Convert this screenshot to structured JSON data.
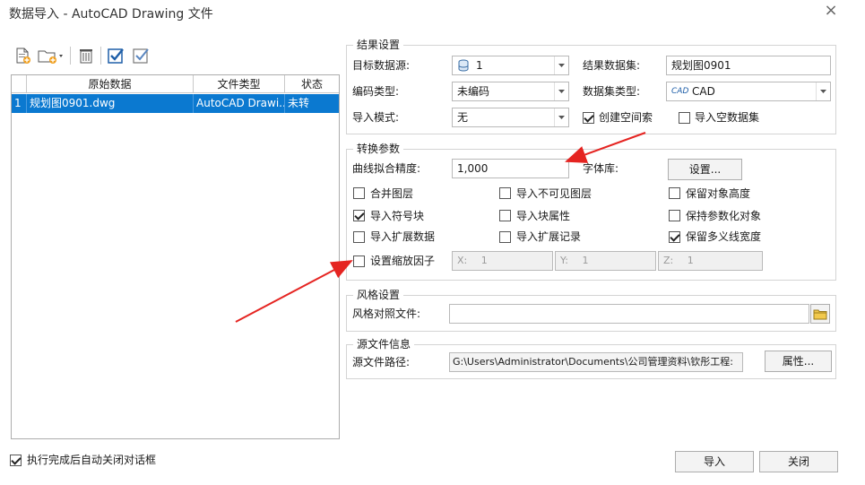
{
  "window": {
    "title": "数据导入 - AutoCAD Drawing 文件",
    "close_glyph": "×"
  },
  "grid": {
    "columns": [
      "",
      "原始数据",
      "文件类型",
      "状态"
    ],
    "rows": [
      {
        "index": "1",
        "source": "规划图0901.dwg",
        "type": "AutoCAD Drawi...",
        "status": "未转"
      }
    ]
  },
  "result": {
    "group_label": "结果设置",
    "target_ds_label": "目标数据源:",
    "target_ds_value": "1",
    "result_dataset_label": "结果数据集:",
    "result_dataset_value": "规划图0901",
    "encoding_label": "编码类型:",
    "encoding_value": "未编码",
    "dataset_type_label": "数据集类型:",
    "dataset_type_value": "CAD",
    "dataset_type_icon_text": "CAD",
    "import_mode_label": "导入模式:",
    "import_mode_value": "无",
    "create_spatial_index": "创建空间索",
    "create_spatial_index_checked": true,
    "import_empty_dataset": "导入空数据集",
    "import_empty_dataset_checked": false
  },
  "conversion": {
    "group_label": "转换参数",
    "curve_precision_label": "曲线拟合精度:",
    "curve_precision_value": "1,000",
    "font_lib_label": "字体库:",
    "settings_button": "设置...",
    "options": [
      {
        "label": "合并图层",
        "checked": false
      },
      {
        "label": "导入不可见图层",
        "checked": false
      },
      {
        "label": "保留对象高度",
        "checked": false
      },
      {
        "label": "导入符号块",
        "checked": true
      },
      {
        "label": "导入块属性",
        "checked": false
      },
      {
        "label": "保持参数化对象",
        "checked": false
      },
      {
        "label": "导入扩展数据",
        "checked": false
      },
      {
        "label": "导入扩展记录",
        "checked": false
      },
      {
        "label": "保留多义线宽度",
        "checked": true
      }
    ],
    "scale_factor_label": "设置缩放因子",
    "scale_factor_checked": false,
    "x_label": "X:",
    "x_value": "1",
    "y_label": "Y:",
    "y_value": "1",
    "z_label": "Z:",
    "z_value": "1"
  },
  "style": {
    "group_label": "风格设置",
    "style_file_label": "风格对照文件:",
    "style_file_value": ""
  },
  "source_info": {
    "group_label": "源文件信息",
    "path_label": "源文件路径:",
    "path_value": "G:\\Users\\Administrator\\Documents\\公司管理资料\\钦彤工程:",
    "properties_button": "属性..."
  },
  "footer": {
    "auto_close_label": "执行完成后自动关闭对话框",
    "auto_close_checked": true,
    "import_button": "导入",
    "close_button": "关闭"
  },
  "colors": {
    "selection": "#0b79d0",
    "arrow": "#e52421",
    "check_icon": "#1f5fa8"
  }
}
